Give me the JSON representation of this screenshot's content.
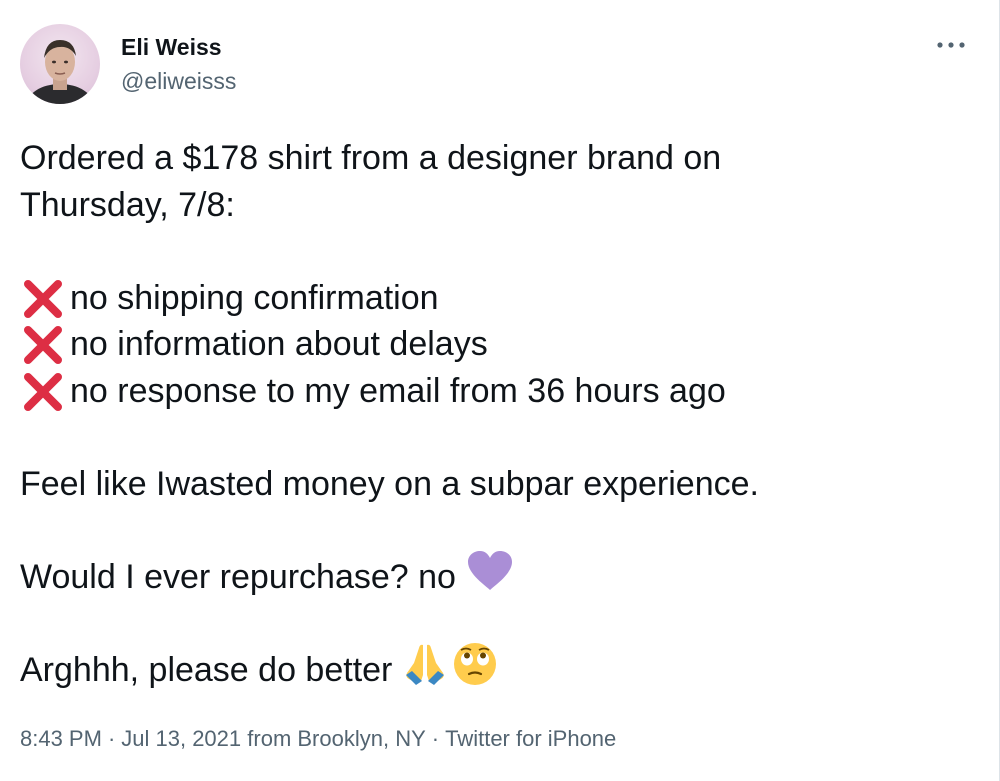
{
  "user": {
    "name": "Eli Weiss",
    "handle": "@eliweisss"
  },
  "menu": {
    "more_icon": "more-horizontal-icon"
  },
  "tweet": {
    "intro_line1": "Ordered a $178 shirt from a designer brand on",
    "intro_line2": "Thursday, 7/8:",
    "list": [
      {
        "icon": "cross-mark-icon",
        "text": "no shipping confirmation"
      },
      {
        "icon": "cross-mark-icon",
        "text": "no information about delays"
      },
      {
        "icon": "cross-mark-icon",
        "text": "no response to my email from 36 hours ago"
      }
    ],
    "line_waste": "Feel like Iwasted money on a subpar experience.",
    "line_repurchase": "Would I ever repurchase? no",
    "line_repurchase_emoji": "purple-heart-icon",
    "line_closing": "Arghhh, please do better",
    "line_closing_emojis": [
      "folded-hands-icon",
      "face-with-rolling-eyes-icon"
    ]
  },
  "footer": {
    "time": "8:43 PM",
    "date": "Jul 13, 2021",
    "location": "from Brooklyn, NY",
    "source": "Twitter for iPhone",
    "separator": "·"
  },
  "colors": {
    "text": "#0f1419",
    "secondary": "#536471",
    "cross": "#dd2e44",
    "heart": "#aa8ed6"
  }
}
